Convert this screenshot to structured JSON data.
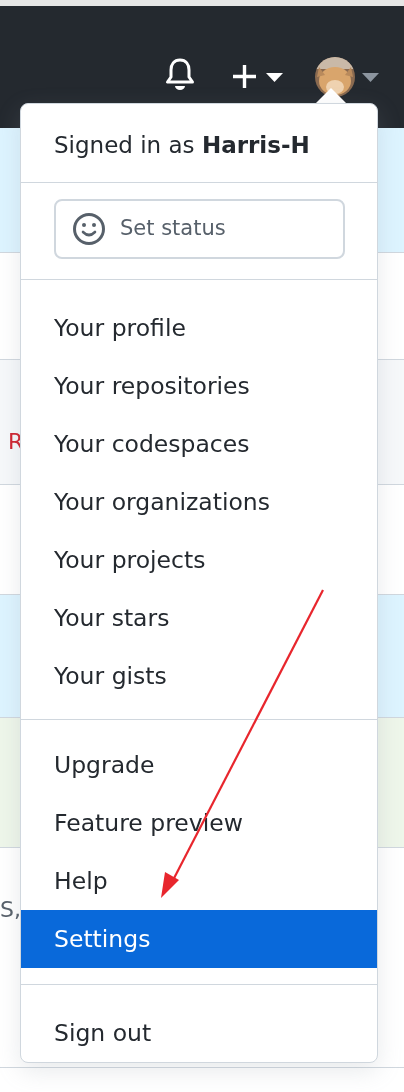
{
  "menu": {
    "signed_in": "Signed in as **Harris-H**",
    "status_button": {
      "label": "Set status"
    },
    "groups": [
      [
        {
          "label": "Your profile",
          "selected": false
        },
        {
          "label": "Your repositories",
          "selected": false
        },
        {
          "label": "Your codespaces",
          "selected": false
        },
        {
          "label": "Your organizations",
          "selected": false
        },
        {
          "label": "Your projects",
          "selected": false
        },
        {
          "label": "Your stars",
          "selected": false
        },
        {
          "label": "Your gists",
          "selected": false
        }
      ],
      [
        {
          "label": "Upgrade",
          "selected": false
        },
        {
          "label": "Feature preview",
          "selected": false
        },
        {
          "label": "Help",
          "selected": false
        },
        {
          "label": "Settings",
          "selected": true
        }
      ],
      [
        {
          "label": "Sign out",
          "selected": false
        }
      ]
    ]
  },
  "background_fragments": [
    {
      "text": "R"
    },
    {
      "text": "S,"
    }
  ]
}
